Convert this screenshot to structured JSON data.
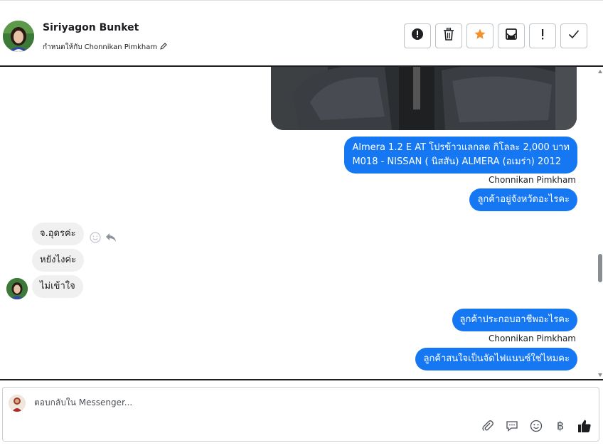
{
  "header": {
    "contact_name": "Siriyagon Bunket",
    "assigned_text": "กำหนดให้กับ Chonnikan Pimkham",
    "toolbar": [
      {
        "icon": "alert-circle-icon",
        "name": "spam-button"
      },
      {
        "icon": "trash-icon",
        "name": "delete-button"
      },
      {
        "icon": "star-icon",
        "name": "star-button"
      },
      {
        "icon": "mark-unread-icon",
        "name": "mark-unread-button"
      },
      {
        "icon": "exclamation-icon",
        "name": "follow-up-button"
      },
      {
        "icon": "check-icon",
        "name": "done-button"
      }
    ],
    "star_color": "#f5902a"
  },
  "conversation": {
    "outgoing_color": "#1677f2",
    "messages_out_1": {
      "line1": "Almera 1.2 E AT โปรข้าวแลกลด กิโลละ 2,000 บาท",
      "line2": "M018 - NISSAN ( นิสสัน) ALMERA (อเมร่า) 2012"
    },
    "sender_1": "Chonnikan Pimkham",
    "message_out_2": "ลูกค้าอยู่จังหวัดอะไรคะ",
    "incoming": [
      "จ.อุดรค่ะ",
      "หยังไงค่ะ",
      "ไม่เข้าใจ"
    ],
    "message_out_3": "ลูกค้าประกอบอาชีพอะไรคะ",
    "sender_2": "Chonnikan Pimkham",
    "message_out_4": "ลูกค้าสนใจเป็นจัดไฟแนนซ์ใช่ไหมคะ"
  },
  "composer": {
    "placeholder": "ตอบกลับใน Messenger...",
    "tools": [
      "attachment-icon",
      "saved-reply-icon",
      "emoji-icon",
      "baht-icon",
      "like-icon"
    ],
    "baht_symbol": "฿"
  }
}
